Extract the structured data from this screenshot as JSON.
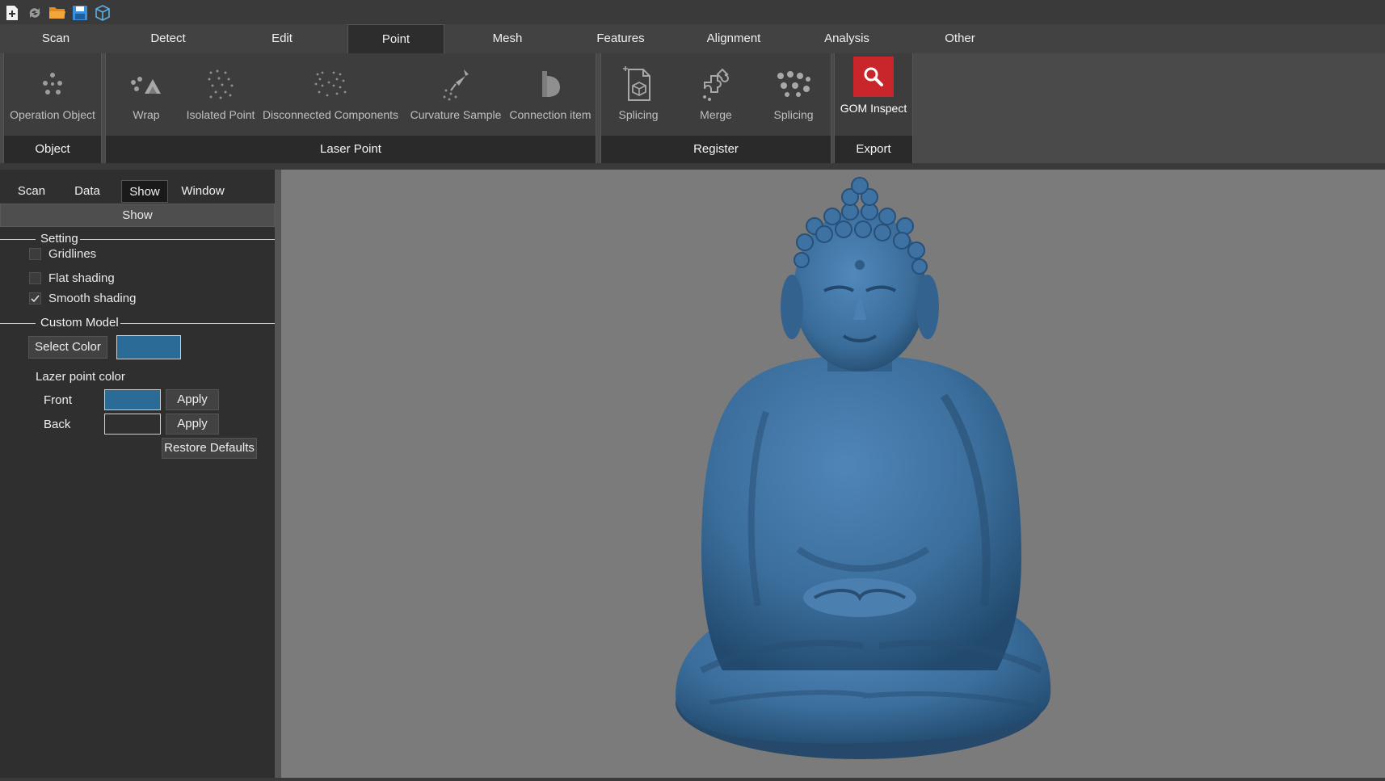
{
  "menu": {
    "tabs": [
      {
        "label": "Scan"
      },
      {
        "label": "Detect"
      },
      {
        "label": "Edit"
      },
      {
        "label": "Point"
      },
      {
        "label": "Mesh"
      },
      {
        "label": "Features"
      },
      {
        "label": "Alignment"
      },
      {
        "label": "Analysis"
      },
      {
        "label": "Other"
      }
    ],
    "active": "Point"
  },
  "ribbon": {
    "object": {
      "label": "Object",
      "buttons": [
        {
          "label": "Operation Object",
          "icon": "dots-icon"
        }
      ]
    },
    "laser_point": {
      "label": "Laser Point",
      "buttons": [
        {
          "label": "Wrap",
          "icon": "wrap-icon"
        },
        {
          "label": "Isolated Point",
          "icon": "isolated-point-icon"
        },
        {
          "label": "Disconnected Components",
          "icon": "disconnected-components-icon"
        },
        {
          "label": "Curvature Sample",
          "icon": "curvature-sample-icon"
        },
        {
          "label": "Connection item",
          "icon": "connection-item-icon"
        }
      ]
    },
    "register": {
      "label": "Register",
      "buttons": [
        {
          "label": "Splicing",
          "icon": "splicing-doc-icon"
        },
        {
          "label": "Merge",
          "icon": "merge-icon"
        },
        {
          "label": "Splicing",
          "icon": "splicing-dots-icon"
        }
      ]
    },
    "export": {
      "label": "Export",
      "buttons": [
        {
          "label": "GOM Inspect",
          "icon": "magnifier-icon"
        }
      ]
    }
  },
  "panel": {
    "tabs": [
      {
        "label": "Scan"
      },
      {
        "label": "Data"
      },
      {
        "label": "Show"
      },
      {
        "label": "Window"
      }
    ],
    "active_tab": "Show",
    "header": "Show",
    "setting": {
      "title": "Setting",
      "options": [
        {
          "label": "Gridlines",
          "checked": false
        },
        {
          "label": "Flat shading",
          "checked": false
        },
        {
          "label": "Smooth shading",
          "checked": true
        }
      ]
    },
    "custom_model": {
      "title": "Custom Model",
      "select_color_label": "Select Color",
      "model_color": "#2a6b97",
      "lazer_title": "Lazer point color",
      "front_label": "Front",
      "front_color": "#2a6b97",
      "back_label": "Back",
      "back_color": "#2f2f2f",
      "apply_label": "Apply",
      "restore_label": "Restore Defaults"
    }
  },
  "colors": {
    "model": "#3b6e9c",
    "viewport_bg": "#7b7b7b",
    "gom_red": "#c8262b"
  }
}
